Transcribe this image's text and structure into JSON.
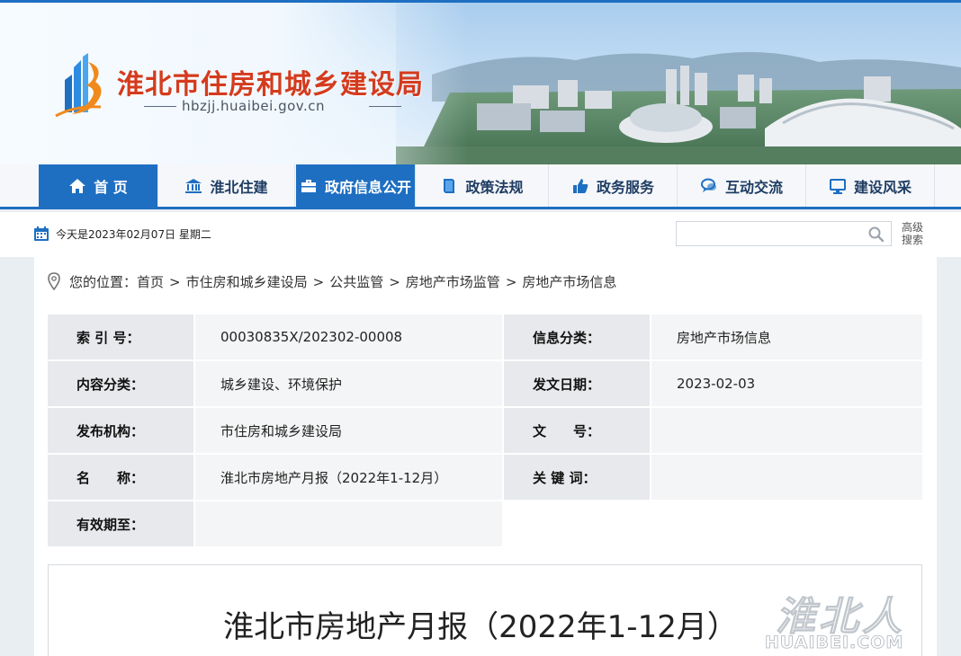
{
  "header": {
    "site_title": "淮北市住房和城乡建设局",
    "site_domain": "hbzjj.huaibei.gov.cn"
  },
  "nav": {
    "items": [
      {
        "label": "首 页",
        "icon": "home-icon"
      },
      {
        "label": "淮北住建",
        "icon": "bank-icon"
      },
      {
        "label": "政府信息公开",
        "icon": "briefcase-icon"
      },
      {
        "label": "政策法规",
        "icon": "book-icon"
      },
      {
        "label": "政务服务",
        "icon": "thumbs-up-icon"
      },
      {
        "label": "互动交流",
        "icon": "chat-icon"
      },
      {
        "label": "建设风采",
        "icon": "monitor-icon"
      }
    ]
  },
  "datebar": {
    "date_text": "今天是2023年02月07日 星期二",
    "search_placeholder": "",
    "advanced_search": "高级搜索"
  },
  "breadcrumb": {
    "prefix": "您的位置：",
    "items": [
      "首页",
      "市住房和城乡建设局",
      "公共监管",
      "房地产市场监管",
      "房地产市场信息"
    ]
  },
  "info": {
    "index_label": "索 引 号：",
    "index_value": "00030835X/202302-00008",
    "category_label": "信息分类：",
    "category_value": "房地产市场信息",
    "content_label": "内容分类：",
    "content_value": "城乡建设、环境保护",
    "date_label": "发文日期：",
    "date_value": "2023-02-03",
    "publisher_label": "发布机构：",
    "publisher_value": "市住房和城乡建设局",
    "doc_no_label": "文　　号：",
    "doc_no_value": "",
    "name_label": "名　　称：",
    "name_value": "淮北市房地产月报（2022年1-12月）",
    "keywords_label": "关 键 词：",
    "keywords_value": "",
    "valid_label": "有效期至：",
    "valid_value": ""
  },
  "article": {
    "title": "淮北市房地产月报（2022年1-12月）"
  },
  "watermark": {
    "cn": "淮北人",
    "en": "HUAIBEI.COM"
  },
  "colors": {
    "brand_blue": "#1e6fc2",
    "title_red": "#d43b1e"
  }
}
